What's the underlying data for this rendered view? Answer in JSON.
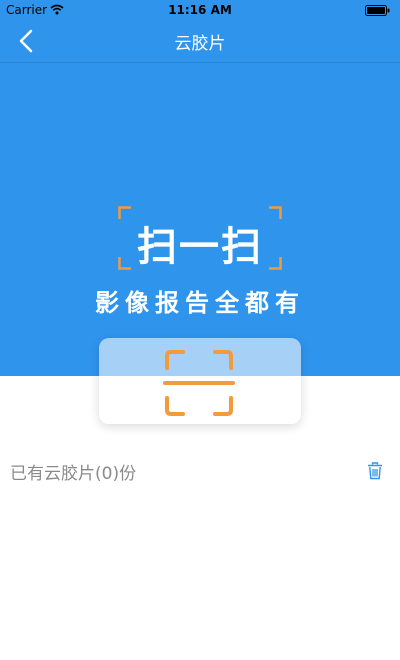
{
  "status_bar": {
    "carrier": "Carrier",
    "time": "11:16 AM",
    "wifi_icon": "wifi-icon",
    "battery_icon": "battery-icon"
  },
  "nav": {
    "back_icon": "chevron-left-icon",
    "title": "云胶片"
  },
  "banner": {
    "scan_title": "扫一扫",
    "slogan": "影像报告全都有"
  },
  "scan_card": {
    "icon": "scan-frame-icon"
  },
  "content": {
    "count_text": "已有云胶片(0)份",
    "delete_icon": "trash-icon"
  },
  "colors": {
    "primary_blue": "#2f94ec",
    "accent_orange": "#f29a3c",
    "text_gray": "#8a8a8a",
    "card_light_blue": "#a6d0f6"
  }
}
